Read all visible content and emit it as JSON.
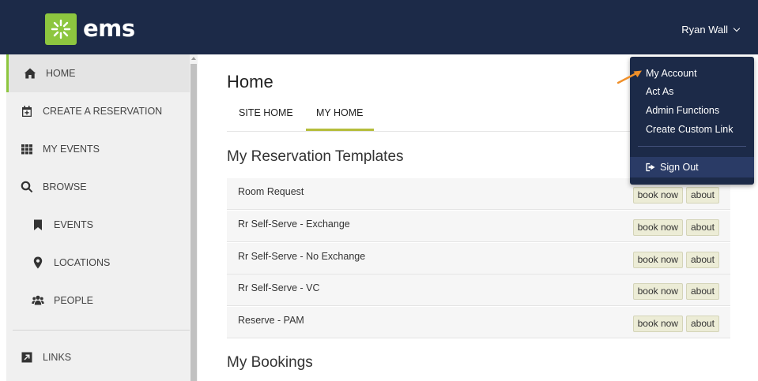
{
  "header": {
    "logo_text": "ems",
    "user_name": "Ryan Wall"
  },
  "sidebar": {
    "items": [
      {
        "label": "HOME",
        "icon": "home-icon"
      },
      {
        "label": "CREATE A RESERVATION",
        "icon": "calendar-plus-icon"
      },
      {
        "label": "MY EVENTS",
        "icon": "grid-icon"
      },
      {
        "label": "BROWSE",
        "icon": "search-icon"
      },
      {
        "label": "EVENTS",
        "icon": "bookmark-icon"
      },
      {
        "label": "LOCATIONS",
        "icon": "map-marker-icon"
      },
      {
        "label": "PEOPLE",
        "icon": "users-icon"
      },
      {
        "label": "LINKS",
        "icon": "external-link-icon"
      }
    ]
  },
  "main": {
    "title": "Home",
    "tabs": [
      {
        "label": "SITE HOME"
      },
      {
        "label": "MY HOME"
      }
    ],
    "templates_title": "My Reservation Templates",
    "templates": [
      {
        "name": "Room Request",
        "book_label": "book now",
        "about_label": "about"
      },
      {
        "name": "Rr Self-Serve - Exchange",
        "book_label": "book now",
        "about_label": "about"
      },
      {
        "name": "Rr Self-Serve - No Exchange",
        "book_label": "book now",
        "about_label": "about"
      },
      {
        "name": "Rr Self-Serve - VC",
        "book_label": "book now",
        "about_label": "about"
      },
      {
        "name": "Reserve - PAM",
        "book_label": "book now",
        "about_label": "about"
      }
    ],
    "bookings_title": "My Bookings"
  },
  "dropdown": {
    "items": [
      {
        "label": "My Account"
      },
      {
        "label": "Act As"
      },
      {
        "label": "Admin Functions"
      },
      {
        "label": "Create Custom Link"
      }
    ],
    "sign_out": "Sign Out"
  },
  "colors": {
    "header_bg": "#1c2a48",
    "accent_green": "#8dc63f",
    "tab_underline": "#b5bd3b",
    "annotation_arrow": "#f0902a"
  }
}
